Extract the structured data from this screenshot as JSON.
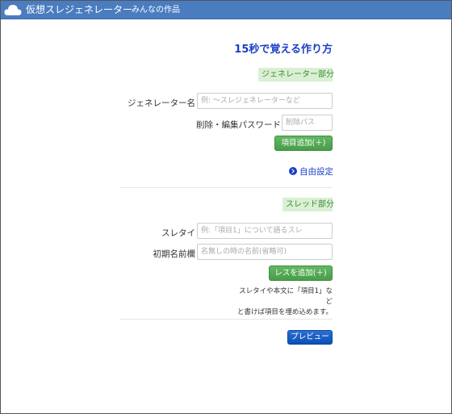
{
  "navbar": {
    "brand": "仮想スレジェネレーター",
    "link_works": "みんなの作品"
  },
  "main": {
    "heading": "15秒で覚える作り方",
    "generator_section": {
      "label": "ジェネレーター部分",
      "name_label": "ジェネレーター名",
      "name_placeholder": "例: ～スレジェネレーターなど",
      "password_label": "削除・編集パスワード",
      "password_placeholder": "削除パス",
      "add_item_button": "項目追加(＋)"
    },
    "free_settings_link": "自由設定",
    "thread_section": {
      "label": "スレッド部分",
      "title_label": "スレタイ",
      "title_placeholder": "例:「項目1」について語るスレ",
      "default_name_label": "初期名前欄",
      "default_name_placeholder": "名無しの時の名前(省略可)",
      "add_res_button": "レスを追加(＋)",
      "help_line1": "スレタイや本文に「項目1」など",
      "help_line2": "と書けば項目を埋め込めます。"
    },
    "preview_button": "プレビュー"
  },
  "colors": {
    "navbar": "#4a7cc0",
    "heading": "#1b3fc4",
    "section_label_bg": "#d9f0d3",
    "button_green": "#4a9d4a",
    "button_blue": "#0c50b3"
  }
}
